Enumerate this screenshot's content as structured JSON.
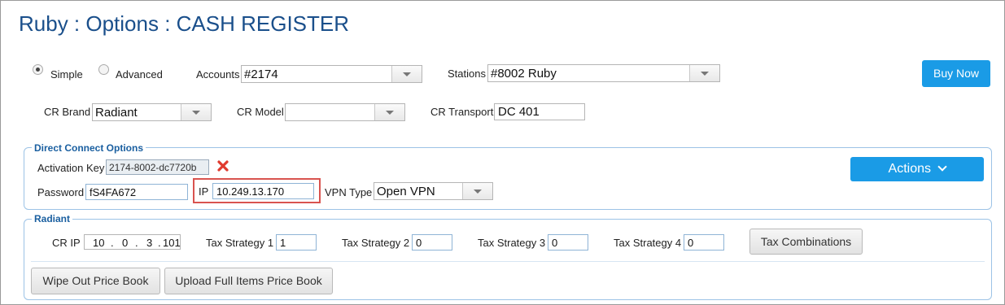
{
  "header": {
    "title": "Ruby : Options : CASH REGISTER"
  },
  "mode": {
    "simple_label": "Simple",
    "advanced_label": "Advanced",
    "selected": "Simple"
  },
  "accounts": {
    "label": "Accounts",
    "value": "#2174"
  },
  "stations": {
    "label": "Stations",
    "value": "#8002 Ruby"
  },
  "buy_now": {
    "label": "Buy Now"
  },
  "cr_brand": {
    "label": "CR Brand",
    "value": "Radiant"
  },
  "cr_model": {
    "label": "CR Model",
    "value": ""
  },
  "cr_transport": {
    "label": "CR Transport",
    "value": "DC 401"
  },
  "direct_connect": {
    "legend": "Direct Connect Options",
    "activation_key_label": "Activation Key",
    "activation_key_value": "2174-8002-dc7720b",
    "password_label": "Password",
    "password_value": "fS4FA672",
    "ip_label": "IP",
    "ip_value": "10.249.13.170",
    "vpn_type_label": "VPN Type",
    "vpn_type_value": "Open VPN",
    "actions_label": "Actions"
  },
  "radiant": {
    "legend": "Radiant",
    "cr_ip_label": "CR IP",
    "cr_ip_octets": [
      "10",
      "0",
      "3",
      "101"
    ],
    "tax_strategy_1_label": "Tax Strategy 1",
    "tax_strategy_1_value": "1",
    "tax_strategy_2_label": "Tax Strategy 2",
    "tax_strategy_2_value": "0",
    "tax_strategy_3_label": "Tax Strategy 3",
    "tax_strategy_3_value": "0",
    "tax_strategy_4_label": "Tax Strategy 4",
    "tax_strategy_4_value": "0",
    "tax_combinations_label": "Tax Combinations",
    "wipe_out_label": "Wipe Out Price Book",
    "upload_label": "Upload Full Items Price Book"
  },
  "colors": {
    "title": "#1a4f8b",
    "accent_button": "#1a9be6",
    "legend_text": "#1a5fa0",
    "highlight_border": "#d9534f",
    "delete_icon": "#e03a2e"
  }
}
